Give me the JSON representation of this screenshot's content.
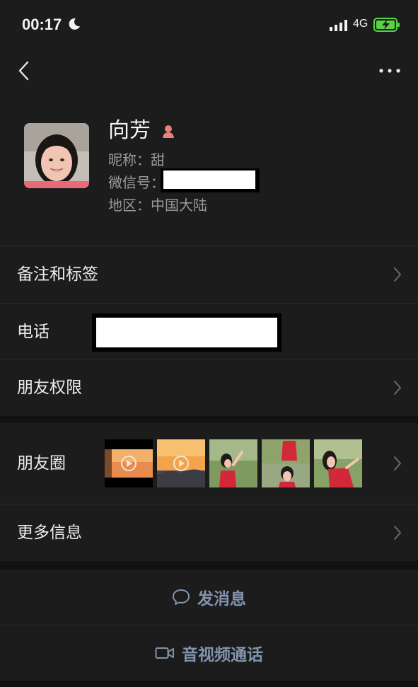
{
  "status_bar": {
    "time": "00:17",
    "network": "4G"
  },
  "profile": {
    "name": "向芳",
    "nickname": "昵称：甜",
    "wechat_id_label": "微信号：",
    "region": "地区：中国大陆"
  },
  "rows": {
    "remark_tags": "备注和标签",
    "phone": "电话",
    "friend_permissions": "朋友权限",
    "moments": "朋友圈",
    "more_info": "更多信息"
  },
  "actions": {
    "send_message": "发消息",
    "video_call": "音视频通话"
  },
  "icons": [
    "moon-icon",
    "signal-icon",
    "battery-charging-icon",
    "back-icon",
    "more-icon",
    "female-icon",
    "chevron-right-icon",
    "chat-bubble-icon",
    "video-camera-icon",
    "play-icon"
  ],
  "colors": {
    "background": "#1c1c1c",
    "accent_link": "#8193ad",
    "battery": "#5ad343",
    "female_badge": "#e7827a"
  }
}
